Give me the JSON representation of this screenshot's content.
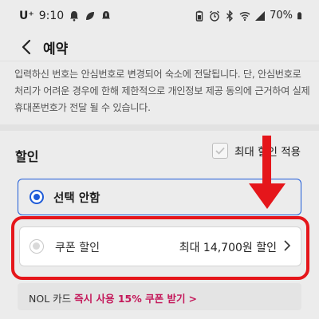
{
  "status_bar": {
    "carrier": "U⁺",
    "time": "9:10",
    "battery": "70%",
    "left_icons": [
      "notification-bell-icon",
      "leaf-icon",
      "alert-bell-icon"
    ],
    "right_icons": [
      "battery-saver-icon",
      "alarm-icon",
      "bluetooth-icon",
      "wifi-icon",
      "signal-icon"
    ]
  },
  "header": {
    "title": "예약"
  },
  "notice": {
    "text": "입력하신 번호는 안심번호로 변경되어 숙소에 전달됩니다. 단, 안심번호로 처리가 어려운 경우에 한해 제한적으로 개인정보 제공 동의에 근거하여 실제 휴대폰번호가 전달 될 수 있습니다."
  },
  "discount": {
    "title": "할인",
    "max_discount_label": "최대 할인 적용",
    "max_discount_checked": false,
    "options": [
      {
        "label": "선택 안함",
        "selected": true
      },
      {
        "label": "쿠폰 할인",
        "value": "최대 14,700원 할인",
        "selected": false
      }
    ],
    "promo": {
      "prefix": "NOL 카드",
      "emphasis": "즉시 사용 15% 쿠폰 받기",
      "suffix": ">"
    }
  },
  "colors": {
    "accent": "#1e5bd8",
    "annotation_red": "#e5161b",
    "promo_emphasis": "#c4185a",
    "background": "#ececec"
  }
}
